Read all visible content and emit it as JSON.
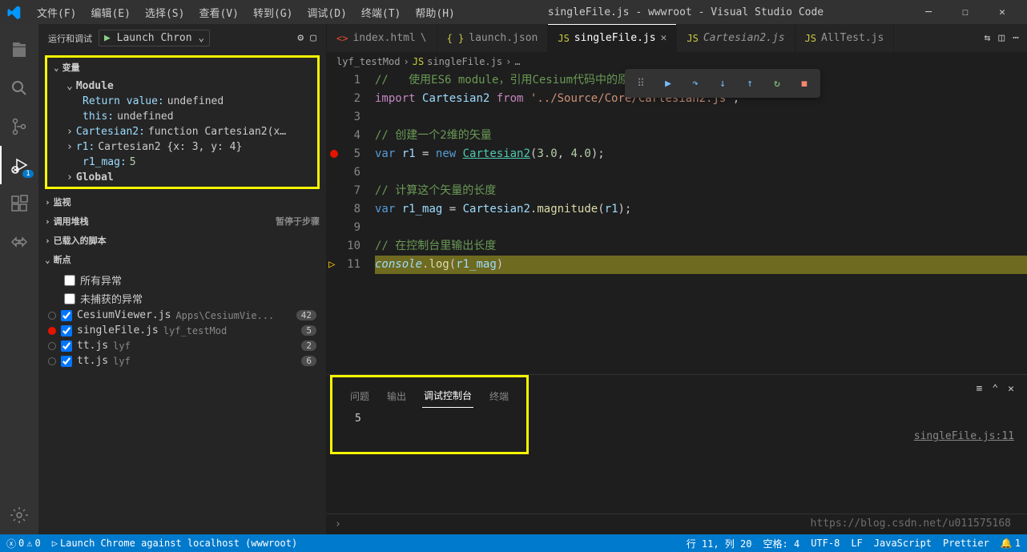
{
  "title": "singleFile.js - wwwroot - Visual Studio Code",
  "menu": [
    "文件(F)",
    "编辑(E)",
    "选择(S)",
    "查看(V)",
    "转到(G)",
    "调试(D)",
    "终端(T)",
    "帮助(H)"
  ],
  "debug": {
    "title": "运行和调试",
    "launch": "Launch Chron",
    "sections": {
      "variables": "变量",
      "module": "Module",
      "watch": "监视",
      "callstack": "调用堆栈",
      "callstack_status": "暂停于步骤",
      "loaded": "已载入的脚本",
      "breakpoints": "断点"
    },
    "vars": {
      "return": "Return value:",
      "return_val": "undefined",
      "this": "this:",
      "this_val": "undefined",
      "cartesian": "Cartesian2:",
      "cartesian_val": "function Cartesian2(x…",
      "r1": "r1:",
      "r1_val": "Cartesian2 {x: 3, y: 4}",
      "r1mag": "r1_mag:",
      "r1mag_val": "5",
      "global": "Global"
    },
    "bp_all_exc": "所有异常",
    "bp_uncaught": "未捕获的异常",
    "bps": [
      {
        "dot": "gray",
        "checked": true,
        "name": "CesiumViewer.js",
        "path": "Apps\\CesiumVie...",
        "count": "42"
      },
      {
        "dot": "red",
        "checked": true,
        "name": "singleFile.js",
        "path": "lyf_testMod",
        "count": "5"
      },
      {
        "dot": "gray",
        "checked": true,
        "name": "tt.js",
        "path": "lyf",
        "count": "2"
      },
      {
        "dot": "gray",
        "checked": true,
        "name": "tt.js",
        "path": "lyf",
        "count": "6"
      }
    ]
  },
  "tabs": [
    {
      "icon": "html",
      "label": "index.html",
      "dirty": "\\"
    },
    {
      "icon": "json",
      "label": "launch.json"
    },
    {
      "icon": "js",
      "label": "singleFile.js",
      "active": true,
      "close": true
    },
    {
      "icon": "js",
      "label": "Cartesian2.js",
      "italic": true
    },
    {
      "icon": "js",
      "label": "AllTest.js"
    }
  ],
  "breadcrumb": [
    "lyf_testMod",
    "singleFile.js",
    "…"
  ],
  "code": {
    "lines": [
      {
        "n": 1,
        "c": "使用ES6 module，引用Cesium代码中的原代码文件",
        "comment": true
      },
      {
        "n": 2
      },
      {
        "n": 3
      },
      {
        "n": 4,
        "c": "创建一个2维的矢量",
        "comment": true
      },
      {
        "n": 5,
        "bp": true
      },
      {
        "n": 6
      },
      {
        "n": 7,
        "c": "计算这个矢量的长度",
        "comment": true
      },
      {
        "n": 8
      },
      {
        "n": 9
      },
      {
        "n": 10,
        "c": "在控制台里输出长度",
        "comment": true
      },
      {
        "n": 11,
        "hl": true,
        "pause": true
      }
    ],
    "l2_import": "import",
    "l2_cart": "Cartesian2",
    "l2_from": "from",
    "l2_str": "'../Source/Core/Cartesian2.js'",
    "l5_var": "var",
    "l5_r1": "r1",
    "l5_new": "new",
    "l5_cart": "Cartesian2",
    "l5_a": "3.0",
    "l5_b": "4.0",
    "l8_var": "var",
    "l8_r1m": "r1_mag",
    "l8_cart": "Cartesian2",
    "l8_mag": "magnitude",
    "l8_arg": "r1",
    "l11_console": "console",
    "l11_log": "log",
    "l11_arg": "r1_mag"
  },
  "panel": {
    "tabs": [
      "问题",
      "输出",
      "调试控制台",
      "终端"
    ],
    "active": 2,
    "output": "5",
    "src": "singleFile.js:11"
  },
  "status": {
    "errors": "0",
    "warnings": "0",
    "launch": "Launch Chrome against localhost (wwwroot)",
    "ln": "行 11, 列 20",
    "spaces": "空格: 4",
    "enc": "UTF-8",
    "eol": "LF",
    "lang": "JavaScript",
    "prettier": "Prettier",
    "bell": "1"
  },
  "watermark": "https://blog.csdn.net/u011575168"
}
